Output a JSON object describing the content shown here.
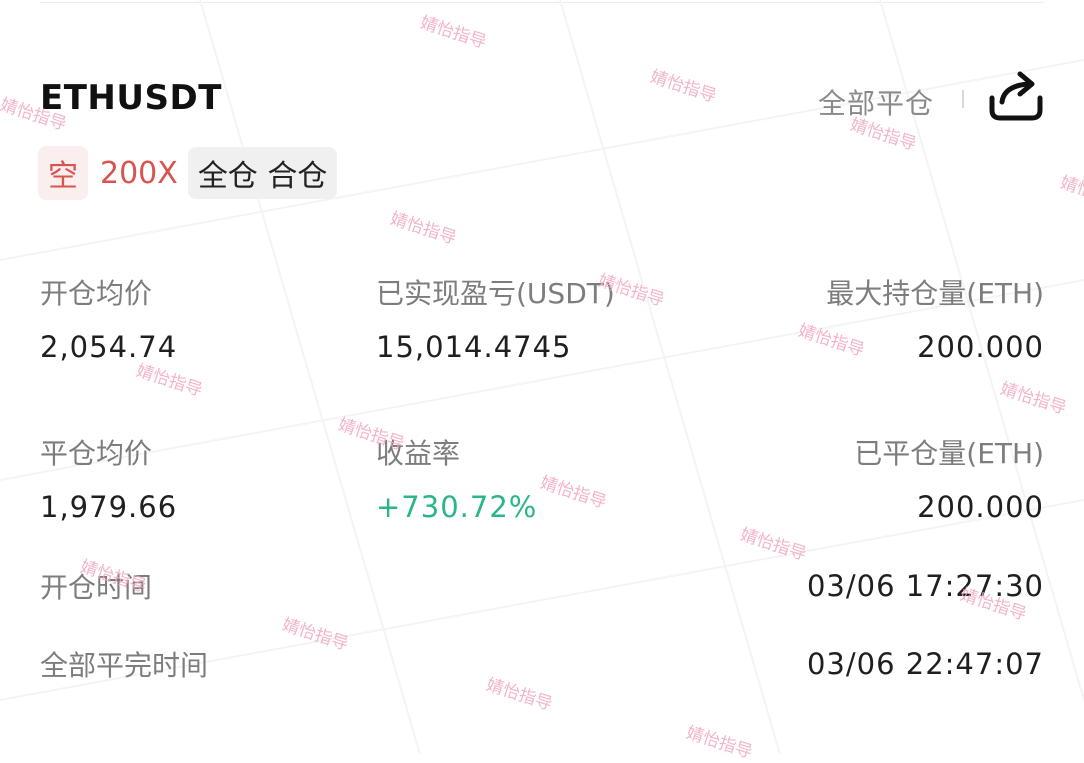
{
  "header": {
    "symbol": "ETHUSDT",
    "close_all_label": "全部平仓",
    "share_icon": "share-icon"
  },
  "tags": {
    "side": "空",
    "leverage": "200X",
    "mode": "全仓 合仓"
  },
  "stats": [
    {
      "label": "开仓均价",
      "value": "2,054.74"
    },
    {
      "label": "已实现盈亏(USDT)",
      "value": "15,014.4745"
    },
    {
      "label": "最大持仓量(ETH)",
      "value": "200.000"
    },
    {
      "label": "平仓均价",
      "value": "1,979.66"
    },
    {
      "label": "收益率",
      "value": "+730.72%"
    },
    {
      "label": "已平仓量(ETH)",
      "value": "200.000"
    }
  ],
  "times": [
    {
      "label": "开仓时间",
      "value": "03/06 17:27:30"
    },
    {
      "label": "全部平完时间",
      "value": "03/06 22:47:07"
    }
  ],
  "watermark": "婧怡指导",
  "colors": {
    "short_red": "#d9534f",
    "profit_green": "#2bb58c",
    "label_gray": "#7d7d7d",
    "watermark_pink": "#f2a7bf"
  }
}
